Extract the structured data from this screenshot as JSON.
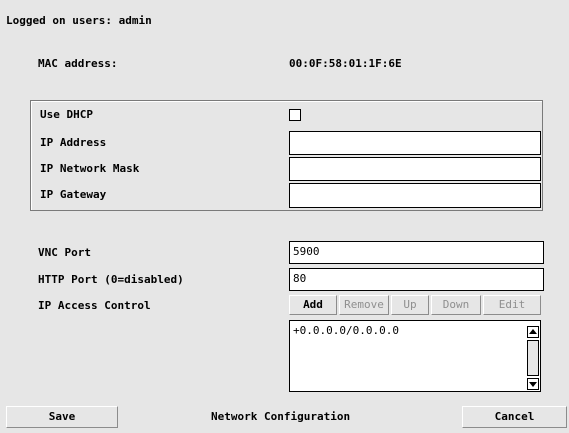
{
  "header": {
    "logged_on": "Logged on users: admin"
  },
  "mac": {
    "label": "MAC address:",
    "value": "00:0F:58:01:1F:6E"
  },
  "network_frame": {
    "use_dhcp_label": "Use DHCP",
    "use_dhcp_checked": false,
    "ip_address_label": "IP Address",
    "ip_address_value": "",
    "ip_mask_label": "IP Network Mask",
    "ip_mask_value": "",
    "ip_gateway_label": "IP Gateway",
    "ip_gateway_value": ""
  },
  "ports": {
    "vnc_label": "VNC Port",
    "vnc_value": "5900",
    "http_label": "HTTP Port (0=disabled)",
    "http_value": "80"
  },
  "access": {
    "label": "IP Access Control",
    "buttons": {
      "add": "Add",
      "remove": "Remove",
      "up": "Up",
      "down": "Down",
      "edit": "Edit"
    },
    "items": [
      "+0.0.0.0/0.0.0.0"
    ]
  },
  "footer": {
    "save": "Save",
    "title": "Network Configuration",
    "cancel": "Cancel"
  }
}
